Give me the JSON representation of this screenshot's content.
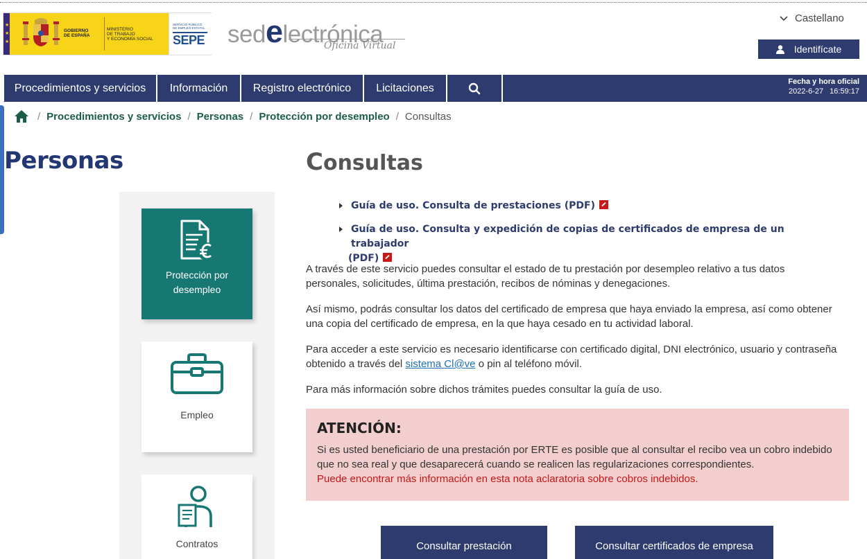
{
  "header": {
    "logo_gov": [
      "GOBIERNO",
      "DE ESPAÑA"
    ],
    "logo_ministry": [
      "MINISTERIO",
      "DE TRABAJO",
      "Y ECONOMÍA SOCIAL"
    ],
    "logo_sepe_small": [
      "SERVICIO PÚBLICO",
      "DE EMPLEO ESTATAL"
    ],
    "logo_sepe_big": "SEPE",
    "sede_pre": "sed",
    "sede_e": "e",
    "sede_post": "lectrónica",
    "sede_sub": "Oficina Virtual",
    "language": "Castellano",
    "login_label": "Identifícate"
  },
  "nav": {
    "items": [
      {
        "label": "Procedimientos y servicios"
      },
      {
        "label": "Información"
      },
      {
        "label": "Registro electrónico"
      },
      {
        "label": "Licitaciones"
      }
    ],
    "time_label": "Fecha y hora oficial",
    "date": "2022-6-27",
    "time": "16:59:17"
  },
  "breadcrumb": {
    "items": [
      "Procedimientos y servicios",
      "Personas",
      "Protección por desempleo"
    ],
    "current": "Consultas"
  },
  "sidebar": {
    "title": "Personas",
    "cards": [
      {
        "label_1": "Protección por",
        "label_2": "desempleo"
      },
      {
        "label_1": "Empleo"
      },
      {
        "label_1": "Contratos"
      }
    ]
  },
  "main": {
    "title_cap": "C",
    "title_rest": "onsultas",
    "docs": [
      {
        "label": "Guía de uso. Consulta de prestaciones (PDF)"
      },
      {
        "label_1": "Guía de uso. Consulta y expedición de copias de certificados de empresa de un trabajador",
        "label_2": "(PDF)"
      }
    ],
    "para_1": "A través de este servicio puedes consultar el estado de tu prestación por desempleo relativo a tus datos personales, solicitudes, última prestación, recibos de nóminas y denegaciones.",
    "para_2": "Así mismo, podrás consultar los datos del certificado de empresa que haya enviado la empresa, así como obtener una copia del certificado de empresa, en la que haya cesado en tu actividad laboral.",
    "para_3_pre": "Para acceder a este servicio es necesario identificarse con certificado digital, DNI electrónico, usuario y contraseña obtenido a través del ",
    "para_3_link": "sistema Cl@ve",
    "para_3_post": " o pin al teléfono móvil.",
    "para_4": "Para más información sobre dichos trámites puedes consultar la guía de uso.",
    "alert_title": "ATENCIÓN:",
    "alert_text": "Si es usted beneficiario de una prestación por ERTE es posible que al consultar el recibo vea un cobro indebido que no sea real y que desaparecerá cuando se realicen las regularizaciones correspondientes.",
    "alert_red": "Puede encontrar más información en esta nota aclaratoria sobre cobros indebidos.",
    "btn_1": "Consultar prestación",
    "btn_2": "Consultar certificados de empresa"
  }
}
